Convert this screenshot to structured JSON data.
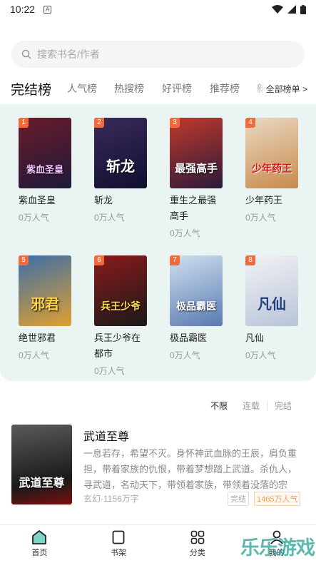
{
  "status": {
    "time": "10:22"
  },
  "search": {
    "placeholder": "搜索书名/作者"
  },
  "tabs": [
    {
      "label": "完结榜"
    },
    {
      "label": "人气榜"
    },
    {
      "label": "热搜榜"
    },
    {
      "label": "好评榜"
    },
    {
      "label": "推荐榜"
    },
    {
      "label": "新"
    }
  ],
  "all_lists_label": "全部榜单 >",
  "ranking": [
    {
      "rank": "1",
      "name": "紫血圣皇",
      "popularity": "0万人气",
      "cover_text": "紫血圣皇",
      "color1": "#6a1b2a",
      "color2": "#1e1a3a"
    },
    {
      "rank": "2",
      "name": "斩龙",
      "popularity": "0万人气",
      "cover_text": "斩龙",
      "color1": "#3a2a5a",
      "color2": "#101030"
    },
    {
      "rank": "3",
      "name": "重生之最强高手",
      "popularity": "0万人气",
      "cover_text": "最强高手",
      "color1": "#c0392b",
      "color2": "#2b1a3a"
    },
    {
      "rank": "4",
      "name": "少年药王",
      "popularity": "0万人气",
      "cover_text": "少年药王",
      "color1": "#e8d9c4",
      "color2": "#c98a4a"
    },
    {
      "rank": "5",
      "name": "绝世邪君",
      "popularity": "0万人气",
      "cover_text": "邪君",
      "color1": "#3b6ea8",
      "color2": "#e0a030"
    },
    {
      "rank": "6",
      "name": "兵王少爷在都市",
      "popularity": "0万人气",
      "cover_text": "兵王少爷",
      "color1": "#8a1a1a",
      "color2": "#1a1a1a"
    },
    {
      "rank": "7",
      "name": "极品霸医",
      "popularity": "0万人气",
      "cover_text": "极品霸医",
      "color1": "#cfe0f0",
      "color2": "#5a7ab0"
    },
    {
      "rank": "8",
      "name": "凡仙",
      "popularity": "0万人气",
      "cover_text": "凡仙",
      "color1": "#f2f2f4",
      "color2": "#b8c4d8"
    }
  ],
  "filters": [
    {
      "label": "不限",
      "active": true
    },
    {
      "label": "连载",
      "active": false
    },
    {
      "label": "完结",
      "active": false
    }
  ],
  "featured": {
    "title": "武道至尊",
    "cover_text": "武道至尊",
    "description": "一息若存，希望不灭。身怀神武血脉的王辰，肩负重担，带着家族的仇恨，带着梦想踏上武道。杀仇人，寻武道，名动天下，带领着家族，带领着没落的宗派，…",
    "meta": "玄幻·1156万字",
    "status_tag": "完结",
    "popularity": "1465万人气"
  },
  "nav": [
    {
      "label": "首页",
      "icon": "home-icon",
      "active": true
    },
    {
      "label": "书架",
      "icon": "bookshelf-icon",
      "active": false
    },
    {
      "label": "分类",
      "icon": "category-grid-icon",
      "active": false
    },
    {
      "label": "我的",
      "icon": "user-icon",
      "active": false
    }
  ],
  "watermark": "乐乐游戏"
}
